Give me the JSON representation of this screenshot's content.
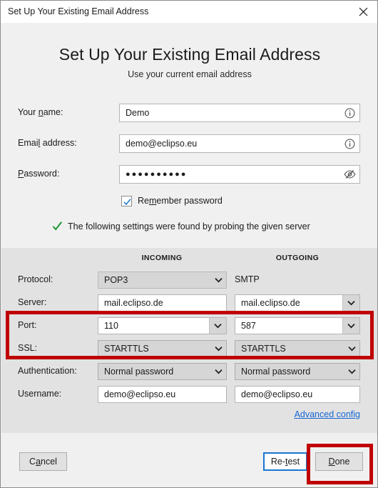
{
  "window": {
    "title": "Set Up Your Existing Email Address",
    "close_icon": "close-icon"
  },
  "header": {
    "heading": "Set Up Your Existing Email Address",
    "subheading": "Use your current email address"
  },
  "credentials": [
    {
      "label": "Your name:",
      "value": "Demo",
      "icon": "info-icon",
      "masked": false
    },
    {
      "label": "Email address:",
      "value": "demo@eclipso.eu",
      "icon": "info-icon",
      "masked": false
    },
    {
      "label": "Password:",
      "value": "●●●●●●●●●●",
      "icon": "eye-off-icon",
      "masked": true
    }
  ],
  "remember": {
    "label": "Remember password",
    "checked": true,
    "check_icon": "checkmark-icon"
  },
  "status": {
    "icon": "green-checkmark-icon",
    "text": "The following settings were found by probing the given server",
    "color": "#1a9433"
  },
  "settings": {
    "column_incoming": "INCOMING",
    "column_outgoing": "OUTGOING",
    "rows": [
      {
        "label": "Protocol:",
        "incoming": {
          "type": "combo-disabled",
          "value": "POP3"
        },
        "outgoing": {
          "type": "static",
          "value": "SMTP"
        }
      },
      {
        "label": "Server:",
        "incoming": {
          "type": "text",
          "value": "mail.eclipso.de"
        },
        "outgoing": {
          "type": "editcombo",
          "value": "mail.eclipso.de"
        }
      },
      {
        "label": "Port:",
        "incoming": {
          "type": "editcombo",
          "value": "110"
        },
        "outgoing": {
          "type": "editcombo",
          "value": "587"
        }
      },
      {
        "label": "SSL:",
        "incoming": {
          "type": "combo",
          "value": "STARTTLS"
        },
        "outgoing": {
          "type": "combo",
          "value": "STARTTLS"
        }
      },
      {
        "label": "Authentication:",
        "incoming": {
          "type": "combo",
          "value": "Normal password"
        },
        "outgoing": {
          "type": "combo",
          "value": "Normal password"
        }
      },
      {
        "label": "Username:",
        "incoming": {
          "type": "text",
          "value": "demo@eclipso.eu"
        },
        "outgoing": {
          "type": "text",
          "value": "demo@eclipso.eu"
        }
      }
    ],
    "advanced_link": "Advanced config"
  },
  "footer": {
    "cancel": "Cancel",
    "retest": "Re-test",
    "done": "Done"
  },
  "annotations": {
    "color": "#c00000",
    "boxes": [
      "port-and-ssl-rows",
      "done-button"
    ]
  }
}
